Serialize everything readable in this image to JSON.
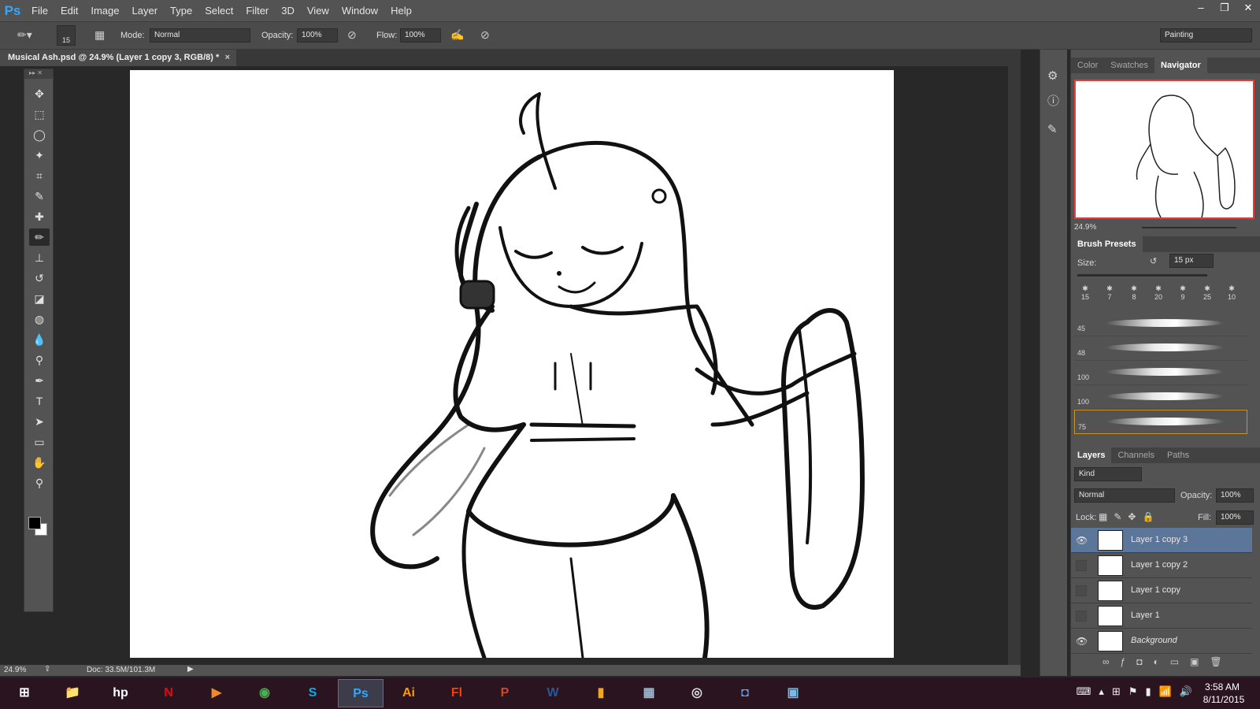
{
  "app": {
    "logo": "Ps",
    "title": "Musical Ash.psd @ 24.9% (Layer 1 copy 3, RGB/8) *"
  },
  "menu": [
    "File",
    "Edit",
    "Image",
    "Layer",
    "Type",
    "Select",
    "Filter",
    "3D",
    "View",
    "Window",
    "Help"
  ],
  "window_controls": [
    "minimize-icon",
    "restore-icon",
    "close-icon"
  ],
  "options": {
    "brush_size": "15",
    "mode_label": "Mode:",
    "mode_value": "Normal",
    "opacity_label": "Opacity:",
    "opacity_value": "100%",
    "flow_label": "Flow:",
    "flow_value": "100%",
    "workspace": "Painting"
  },
  "doc_tab": {
    "title": "Musical Ash.psd @ 24.9% (Layer 1 copy 3, RGB/8) *",
    "close": "×"
  },
  "tools": [
    "move-icon",
    "marquee-icon",
    "lasso-icon",
    "magic-wand-icon",
    "crop-icon",
    "eyedropper-icon",
    "healing-icon",
    "brush-icon",
    "stamp-icon",
    "history-brush-icon",
    "eraser-icon",
    "bucket-icon",
    "blur-icon",
    "dodge-icon",
    "pen-icon",
    "type-icon",
    "path-select-icon",
    "rectangle-icon",
    "hand-icon",
    "zoom-icon"
  ],
  "tool_glyphs": [
    "✥",
    "⬚",
    "◯",
    "✦",
    "⌗",
    "✎",
    "✚",
    "✏",
    "⊥",
    "↺",
    "◪",
    "◍",
    "💧",
    "⚲",
    "✒",
    "T",
    "➤",
    "▭",
    "✋",
    "⚲"
  ],
  "colors": {
    "foreground": "#000000",
    "background": "#ffffff",
    "accent": "#5c7699",
    "nav_frame": "#e53b3b"
  },
  "status": {
    "zoom": "24.9%",
    "doc": "Doc: 33.5M/101.3M"
  },
  "panels": {
    "nav_tabs": [
      "Color",
      "Swatches",
      "Navigator"
    ],
    "nav_zoom": "24.9%",
    "brush_presets_title": "Brush Presets",
    "size_label": "Size:",
    "size_value": "15 px",
    "brush_tips": [
      "15",
      "7",
      "8",
      "20",
      "9",
      "25",
      "10"
    ],
    "brush_list": [
      "45",
      "48",
      "100",
      "100",
      "75"
    ],
    "layers_tabs": [
      "Layers",
      "Channels",
      "Paths"
    ],
    "kind_label": "Kind",
    "blend_mode": "Normal",
    "opacity_label": "Opacity:",
    "opacity_value": "100%",
    "lock_label": "Lock:",
    "fill_label": "Fill:",
    "fill_value": "100%",
    "layers": [
      {
        "name": "Layer 1 copy 3",
        "visible": true,
        "selected": true
      },
      {
        "name": "Layer 1 copy 2",
        "visible": false,
        "selected": false
      },
      {
        "name": "Layer 1 copy",
        "visible": false,
        "selected": false
      },
      {
        "name": "Layer 1",
        "visible": false,
        "selected": false
      },
      {
        "name": "Background",
        "visible": true,
        "selected": false
      }
    ]
  },
  "taskbar": {
    "apps": [
      {
        "name": "windows-icon",
        "label": "⊞",
        "color": "#ffffff"
      },
      {
        "name": "explorer-icon",
        "label": "📁",
        "color": "#e6b94a"
      },
      {
        "name": "hp-icon",
        "label": "hp",
        "color": "#ffffff"
      },
      {
        "name": "netflix-icon",
        "label": "N",
        "color": "#e50914"
      },
      {
        "name": "media-icon",
        "label": "▶",
        "color": "#f08a24"
      },
      {
        "name": "chrome-icon",
        "label": "◉",
        "color": "#4caf50"
      },
      {
        "name": "skype-icon",
        "label": "S",
        "color": "#00aff0"
      },
      {
        "name": "photoshop-icon",
        "label": "Ps",
        "color": "#31a8ff"
      },
      {
        "name": "illustrator-icon",
        "label": "Ai",
        "color": "#ff9a00"
      },
      {
        "name": "flash-icon",
        "label": "Fl",
        "color": "#ff3d00"
      },
      {
        "name": "powerpoint-icon",
        "label": "P",
        "color": "#d24726"
      },
      {
        "name": "word-icon",
        "label": "W",
        "color": "#2b579a"
      },
      {
        "name": "files-icon",
        "label": "▮",
        "color": "#f5a623"
      },
      {
        "name": "calculator-icon",
        "label": "▦",
        "color": "#9fb7d0"
      },
      {
        "name": "webcam-icon",
        "label": "◎",
        "color": "#dddddd"
      },
      {
        "name": "outlook-icon",
        "label": "◘",
        "color": "#5aa0e6"
      },
      {
        "name": "photos-icon",
        "label": "▣",
        "color": "#7ab8e8"
      }
    ],
    "time": "3:58 AM",
    "date": "8/11/2015"
  }
}
